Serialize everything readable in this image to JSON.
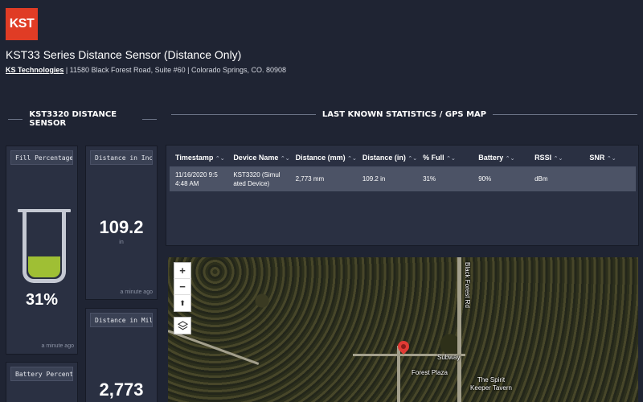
{
  "header": {
    "logo_text": "KST",
    "title": "KST33 Series Distance Sensor (Distance Only)",
    "company_link": "KS Technologies",
    "address": " | 11580 Black Forest Road, Suite #60 | Colorado Springs, CO. 80908"
  },
  "sections": {
    "left_title": "KST3320 DISTANCE SENSOR",
    "right_title": "LAST KNOWN STATISTICS / GPS MAP"
  },
  "widgets": {
    "fill": {
      "title": "Fill Percentage",
      "value": "31%",
      "fill_percent": 31,
      "updated": "a minute ago"
    },
    "inches": {
      "title": "Distance in Inches",
      "value": "109.2",
      "unit": "in",
      "updated": "a minute ago"
    },
    "mm": {
      "title": "Distance in Millimeters",
      "value": "2,773"
    },
    "battery": {
      "title": "Battery Percentage"
    }
  },
  "table": {
    "columns": [
      "Timestamp",
      "Device Name",
      "Distance (mm)",
      "Distance (in)",
      "% Full",
      "Battery",
      "RSSI",
      "SNR"
    ],
    "sort_icon": "⌃⌄",
    "rows": [
      [
        "11/16/2020 9:5 4:48 AM",
        "KST3320 (Simul ated Device)",
        "2,773 mm",
        "109.2 in",
        "31%",
        "90%",
        "dBm",
        ""
      ]
    ]
  },
  "map": {
    "zoom_in": "+",
    "zoom_out": "−",
    "compass": "⬆",
    "layers_icon": "layers-icon",
    "labels": {
      "road": "Black Forest Rd",
      "subway": "Subway",
      "plaza": "Forest Plaza",
      "tavern": "The Spirit Keeper Tavern"
    }
  },
  "colors": {
    "brand": "#e03c25",
    "fill": "#9fbf34",
    "bg": "#1f2433",
    "card": "#2a3042"
  }
}
